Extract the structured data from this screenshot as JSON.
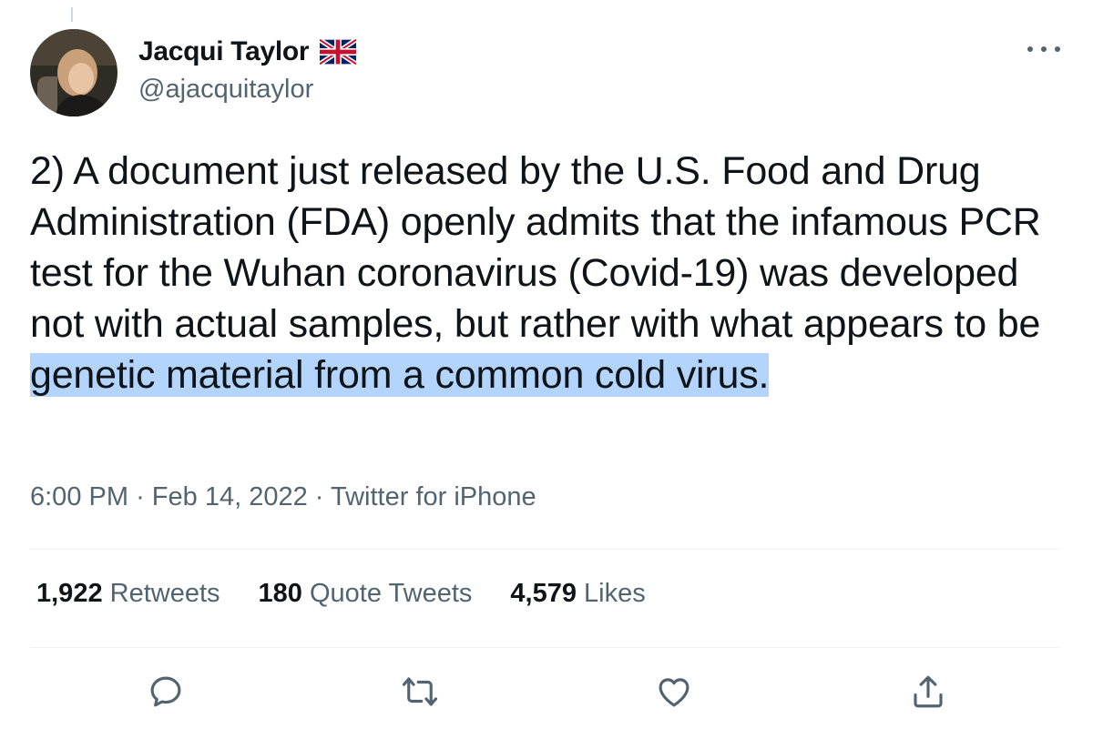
{
  "author": {
    "name": "Jacqui Taylor",
    "handle": "@ajacquitaylor",
    "flag_icon": "uk-flag-icon"
  },
  "tweet": {
    "text_plain": "2) A document just released by the U.S. Food and Drug Administration (FDA) openly admits that the infamous PCR test for the Wuhan coronavirus (Covid-19) was developed not with actual samples, but rather with what appears to be ",
    "text_highlighted": "genetic material from a common cold virus.",
    "time": "6:00 PM",
    "date": "Feb 14, 2022",
    "source": "Twitter for iPhone",
    "separator": "·"
  },
  "stats": {
    "retweets_count": "1,922",
    "retweets_label": "Retweets",
    "quotes_count": "180",
    "quotes_label": "Quote Tweets",
    "likes_count": "4,579",
    "likes_label": "Likes"
  },
  "actions": [
    "reply-icon",
    "retweet-icon",
    "like-icon",
    "share-icon"
  ],
  "colors": {
    "text": "#0f1419",
    "secondary": "#536471",
    "highlight": "#b3d4fc",
    "divider": "#eff3f4"
  }
}
